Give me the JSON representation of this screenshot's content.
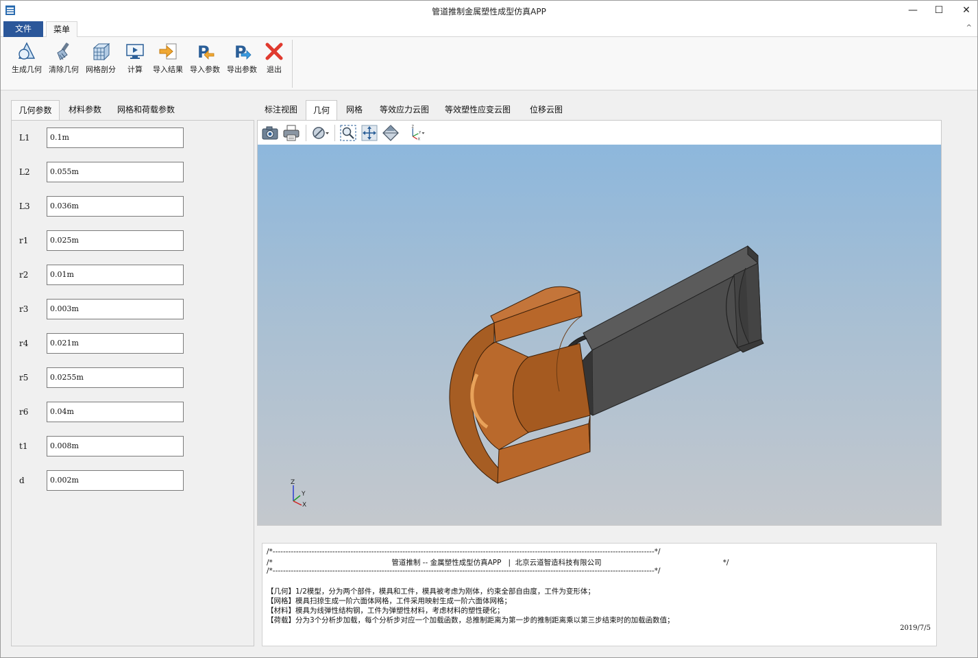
{
  "window": {
    "title": "管道推制金属塑性成型仿真APP",
    "min_glyph": "—",
    "max_glyph": "☐",
    "close_glyph": "✕"
  },
  "ribbon": {
    "tabs": {
      "file": "文件",
      "menu": "菜单"
    },
    "collapse_glyph": "^",
    "buttons": [
      {
        "label": "生成几何",
        "icon": "generate-geometry-icon"
      },
      {
        "label": "清除几何",
        "icon": "brush-icon"
      },
      {
        "label": "网格剖分",
        "icon": "mesh-cube-icon"
      },
      {
        "label": "计算",
        "icon": "monitor-play-icon"
      },
      {
        "label": "导入结果",
        "icon": "import-arrow-icon"
      },
      {
        "label": "导入参数",
        "icon": "p-import-icon"
      },
      {
        "label": "导出参数",
        "icon": "p-export-icon"
      },
      {
        "label": "退出",
        "icon": "red-x-icon"
      }
    ]
  },
  "left_tabs": [
    "几何参数",
    "材料参数",
    "网格和荷载参数"
  ],
  "params": [
    {
      "label": "L1",
      "value": "0.1m"
    },
    {
      "label": "L2",
      "value": "0.055m"
    },
    {
      "label": "L3",
      "value": "0.036m"
    },
    {
      "label": "r1",
      "value": "0.025m"
    },
    {
      "label": "r2",
      "value": "0.01m"
    },
    {
      "label": "r3",
      "value": "0.003m"
    },
    {
      "label": "r4",
      "value": "0.021m"
    },
    {
      "label": "r5",
      "value": "0.0255m"
    },
    {
      "label": "r6",
      "value": "0.04m"
    },
    {
      "label": "t1",
      "value": "0.008m"
    },
    {
      "label": "d",
      "value": "0.002m"
    }
  ],
  "right_tabs": [
    "标注视图",
    "几何",
    "网格",
    "等效应力云图",
    "等效塑性应变云图",
    "位移云图"
  ],
  "active_right_tab": "几何",
  "viewer": {
    "colors": {
      "sky_top": "#8db7dc",
      "sky_bottom": "#c4c8cd",
      "die": "#b8672a",
      "workpiece": "#4a4a4a"
    },
    "axis_labels": {
      "z": "Z",
      "y": "Y",
      "x": "X"
    }
  },
  "output": {
    "lines": [
      "/*---------------------------------------------------------------------------------------------------------------------------------------------------*/",
      "/*                                                    管道推制 -- 金属塑性成型仿真APP   |  北京云道智造科技有限公司                                                     */",
      "/*---------------------------------------------------------------------------------------------------------------------------------------------------*/",
      "",
      "【几何】1/2模型，分为两个部件，模具和工件，模具被考虑为刚体，约束全部自由度，工件为变形体；",
      "【网格】模具扫掠生成一阶六面体网格，工件采用映射生成一阶六面体网格；",
      "【材料】模具为线弹性结构钢，工件为弹塑性材料，考虑材料的塑性硬化；",
      "【荷载】分为3个分析步加载，每个分析步对应一个加载函数，总推制距离为第一步的推制距离乘以第三步结束时的加载函数值；"
    ],
    "date": "2019/7/5"
  }
}
